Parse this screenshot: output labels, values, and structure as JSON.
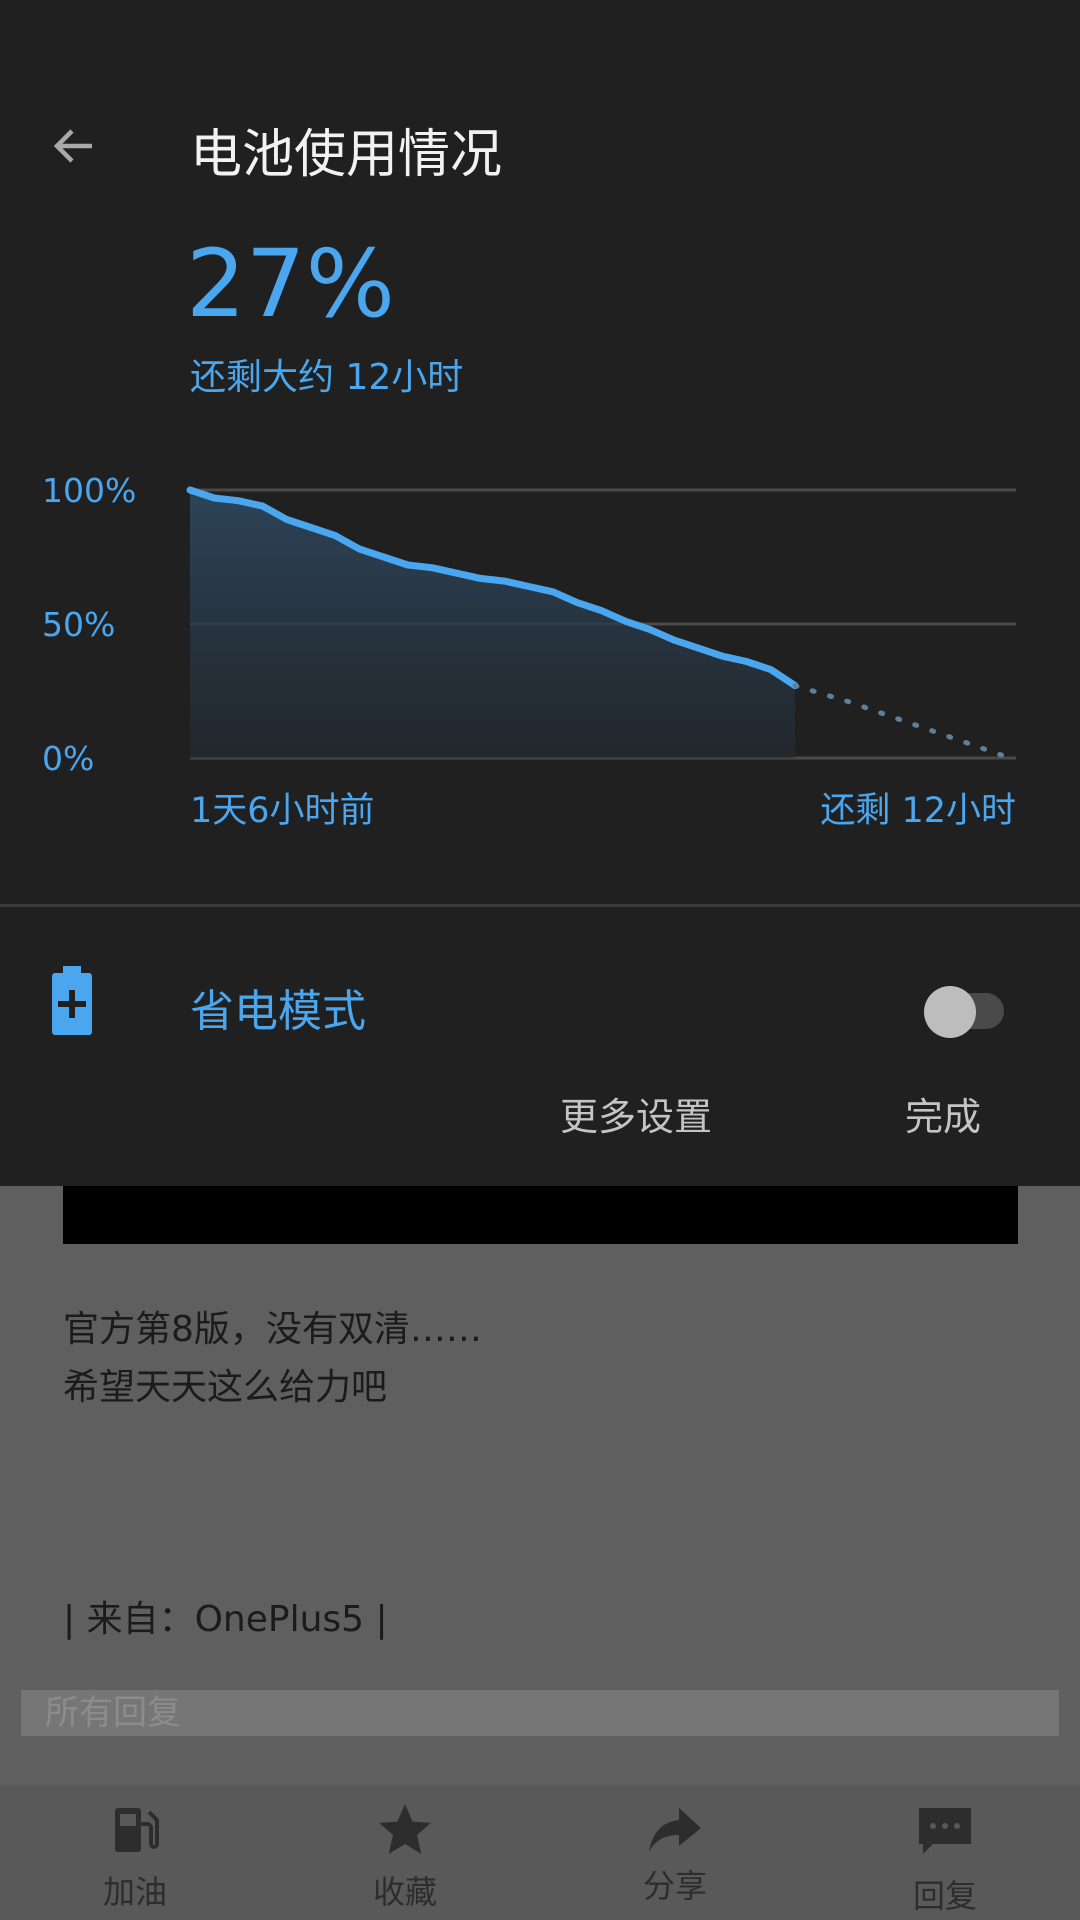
{
  "panel": {
    "title": "电池使用情况",
    "percent": "27%",
    "remaining": "还剩大约 12小时",
    "saver_label": "省电模式",
    "saver_enabled": false,
    "more_settings": "更多设置",
    "done": "完成",
    "accent_color": "#4aa7ef"
  },
  "chart_data": {
    "type": "line",
    "y_ticks": [
      "100%",
      "50%",
      "0%"
    ],
    "x_start_label": "1天6小时前",
    "x_end_label": "还剩 12小时",
    "ylim": [
      0,
      100
    ],
    "grid": true,
    "history_values": [
      100,
      97,
      96,
      94,
      89,
      86,
      83,
      78,
      75,
      72,
      71,
      69,
      67,
      66,
      64,
      62,
      58,
      55,
      51,
      48,
      44,
      41,
      38,
      36,
      33,
      27
    ],
    "projection_values": [
      27,
      21,
      14,
      7,
      0
    ]
  },
  "post": {
    "line1": "官方第8版，没有双清……",
    "line2": "希望天天这么给力吧",
    "source": "| 来自：OnePlus5 |"
  },
  "replies_header": "所有回复",
  "bottom_nav": {
    "items": [
      {
        "label": "加油",
        "icon": "fuel-pump-icon"
      },
      {
        "label": "收藏",
        "icon": "star-icon"
      },
      {
        "label": "分享",
        "icon": "share-icon"
      },
      {
        "label": "回复",
        "icon": "comment-icon"
      }
    ]
  }
}
